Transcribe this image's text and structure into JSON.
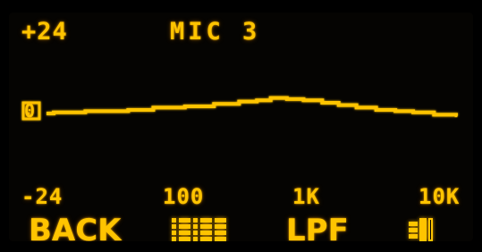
{
  "display": {
    "title": "MIC 3",
    "gain_max": "+24",
    "gain_min": "-24",
    "zero_marker": "0",
    "freq_labels": [
      "100",
      "1K",
      "10K"
    ],
    "color": "#ffc400"
  },
  "softkeys": {
    "back_label": "BACK",
    "eq_icon": "eq-bands-icon",
    "lpf_label": "LPF",
    "speaker_icon": "speaker-icon"
  },
  "chart_data": {
    "type": "line",
    "xscale": "log",
    "ylim": [
      -24,
      24
    ],
    "x": [
      20,
      30,
      50,
      80,
      100,
      150,
      250,
      400,
      600,
      800,
      1000,
      1300,
      1700,
      2300,
      3000,
      4000,
      5500,
      7500,
      10000,
      14000,
      20000
    ],
    "y": [
      -1.5,
      -1.0,
      -0.5,
      -0.5,
      0.0,
      1.0,
      1.5,
      2.5,
      3.5,
      4.0,
      5.0,
      4.5,
      4.0,
      3.0,
      2.0,
      1.0,
      0.0,
      -0.5,
      -1.0,
      -2.0,
      -2.5
    ],
    "xticks": [
      "100",
      "1K",
      "10K"
    ],
    "ytick_labels": [
      "+24",
      "-24"
    ]
  }
}
